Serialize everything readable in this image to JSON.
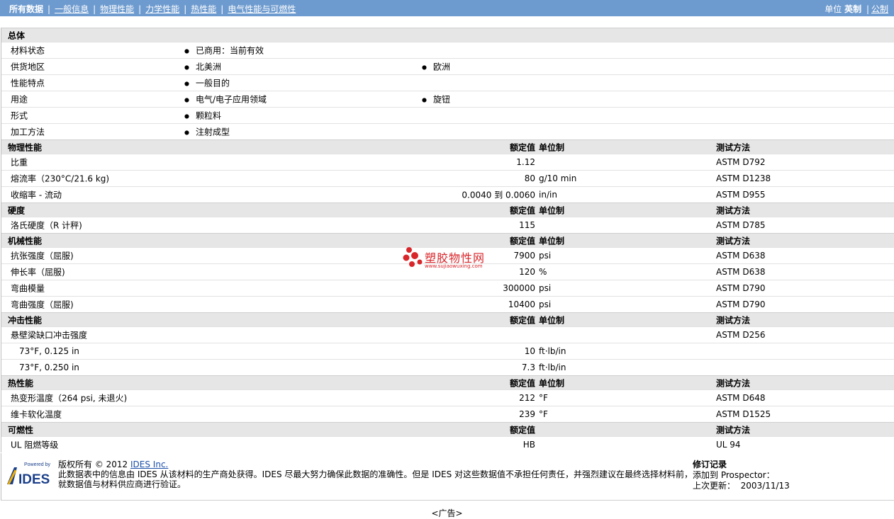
{
  "nav": {
    "items": [
      "所有数据",
      "一般信息",
      "物理性能",
      "力学性能",
      "热性能",
      "电气性能与可燃性"
    ],
    "units_label": "单位",
    "unit_selected": "英制",
    "unit_other": "公制"
  },
  "general": {
    "title": "总体",
    "rows": [
      {
        "label": "材料状态",
        "b1": "已商用：当前有效",
        "b2": ""
      },
      {
        "label": "供货地区",
        "b1": "北美洲",
        "b2": "欧洲"
      },
      {
        "label": "性能特点",
        "b1": "一般目的",
        "b2": ""
      },
      {
        "label": "用途",
        "b1": "电气/电子应用领域",
        "b2": "旋钮"
      },
      {
        "label": "形式",
        "b1": "颗粒料",
        "b2": ""
      },
      {
        "label": "加工方法",
        "b1": "注射成型",
        "b2": ""
      }
    ]
  },
  "headers": {
    "value": "额定值",
    "unit": "单位制",
    "method": "测试方法"
  },
  "physical": {
    "title": "物理性能",
    "rows": [
      {
        "label": "比重",
        "value": "1.12",
        "unit": "",
        "method": "ASTM D792"
      },
      {
        "label": "熔流率（230°C/21.6 kg)",
        "value": "80",
        "unit": "g/10 min",
        "method": "ASTM D1238"
      },
      {
        "label": "收缩率 - 流动",
        "value": "0.0040 到 0.0060",
        "unit": "in/in",
        "method": "ASTM D955"
      }
    ]
  },
  "hardness": {
    "title": "硬度",
    "rows": [
      {
        "label": "洛氏硬度（R 计秤)",
        "value": "115",
        "unit": "",
        "method": "ASTM D785"
      }
    ]
  },
  "mechanical": {
    "title": "机械性能",
    "rows": [
      {
        "label": "抗张强度（屈服)",
        "value": "7900",
        "unit": "psi",
        "method": "ASTM D638"
      },
      {
        "label": "伸长率（屈服)",
        "value": "120",
        "unit": "%",
        "method": "ASTM D638"
      },
      {
        "label": "弯曲模量",
        "value": "300000",
        "unit": "psi",
        "method": "ASTM D790"
      },
      {
        "label": "弯曲强度（屈服)",
        "value": "10400",
        "unit": "psi",
        "method": "ASTM D790"
      }
    ]
  },
  "impact": {
    "title": "冲击性能",
    "rows": [
      {
        "label": "悬壁梁缺口冲击强度",
        "value": "",
        "unit": "",
        "method": "ASTM D256"
      },
      {
        "label": "73°F, 0.125 in",
        "value": "10",
        "unit": "ft·lb/in",
        "method": ""
      },
      {
        "label": "73°F, 0.250 in",
        "value": "7.3",
        "unit": "ft·lb/in",
        "method": ""
      }
    ]
  },
  "thermal": {
    "title": "热性能",
    "rows": [
      {
        "label": "热变形温度（264 psi, 未退火)",
        "value": "212",
        "unit": "°F",
        "method": "ASTM D648"
      },
      {
        "label": "维卡软化温度",
        "value": "239",
        "unit": "°F",
        "method": "ASTM D1525"
      }
    ]
  },
  "flammability": {
    "title": "可燃性",
    "rows": [
      {
        "label": "UL 阻燃等级",
        "value": "HB",
        "unit": "",
        "method": "UL 94"
      }
    ]
  },
  "footer": {
    "logo_top": "Powered by",
    "logo_name": "IDES",
    "copyright": "版权所有  © 2012",
    "copyright_link": "IDES Inc.",
    "disclaimer_1": "此数据表中的信息由 IDES 从该材料的生产商处获得。IDES 尽最大努力确保此数据的准确性。但是 IDES 对这些数据值不承担任何责任，并强烈建议在最终选择材料前，",
    "disclaimer_2": "就数据值与材料供应商进行验证。",
    "revision_title": "修订记录",
    "added_label": "添加到  Prospector：",
    "updated_label": "上次更新：",
    "updated_value": "2003/11/13"
  },
  "watermark": {
    "name": "塑胶物性网",
    "url": "www.sujiaowuxing.com"
  },
  "ad_label": "<广告>",
  "colors": {
    "topbar": "#6e9bcf",
    "header_row": "#e6e6e6",
    "link": "#1a4ea8",
    "watermark": "#d8262b"
  }
}
